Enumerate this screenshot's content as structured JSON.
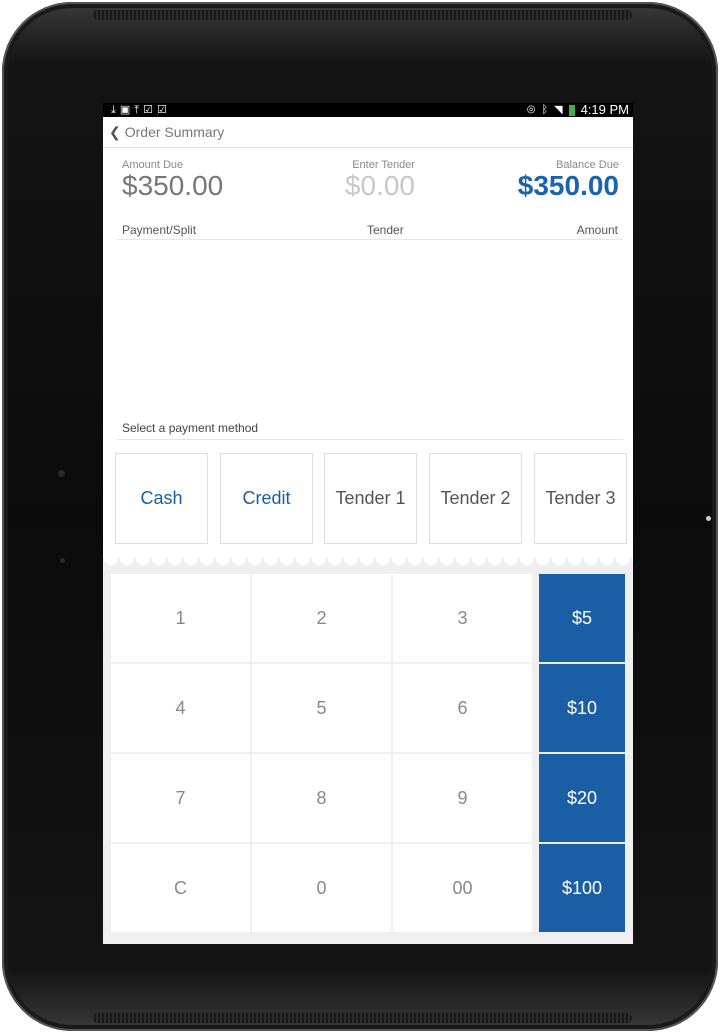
{
  "status_bar": {
    "left_icons": [
      "download-icon",
      "image-icon",
      "upload-icon",
      "bag-check-icon",
      "bag-check-icon"
    ],
    "right_icons": [
      "eye-icon",
      "bluetooth-icon",
      "wifi-icon",
      "battery-icon"
    ],
    "time": "4:19 PM"
  },
  "nav": {
    "back_label": "Order Summary"
  },
  "summary": {
    "amount_due_label": "Amount Due",
    "amount_due_value": "$350.00",
    "enter_tender_label": "Enter Tender",
    "enter_tender_value": "$0.00",
    "balance_due_label": "Balance Due",
    "balance_due_value": "$350.00"
  },
  "table": {
    "columns": [
      "Payment/Split",
      "Tender",
      "Amount"
    ],
    "rows": []
  },
  "payment": {
    "title": "Select a payment method",
    "methods": [
      "Cash",
      "Credit",
      "Tender 1",
      "Tender 2",
      "Tender 3"
    ]
  },
  "keypad": {
    "keys": [
      "1",
      "2",
      "3",
      "4",
      "5",
      "6",
      "7",
      "8",
      "9",
      "C",
      "0",
      "00"
    ],
    "quick_amounts": [
      "$5",
      "$10",
      "$20",
      "$100"
    ]
  },
  "colors": {
    "accent": "#1a5ea6",
    "balance": "#1a64ad",
    "battery": "#3cb24a"
  }
}
